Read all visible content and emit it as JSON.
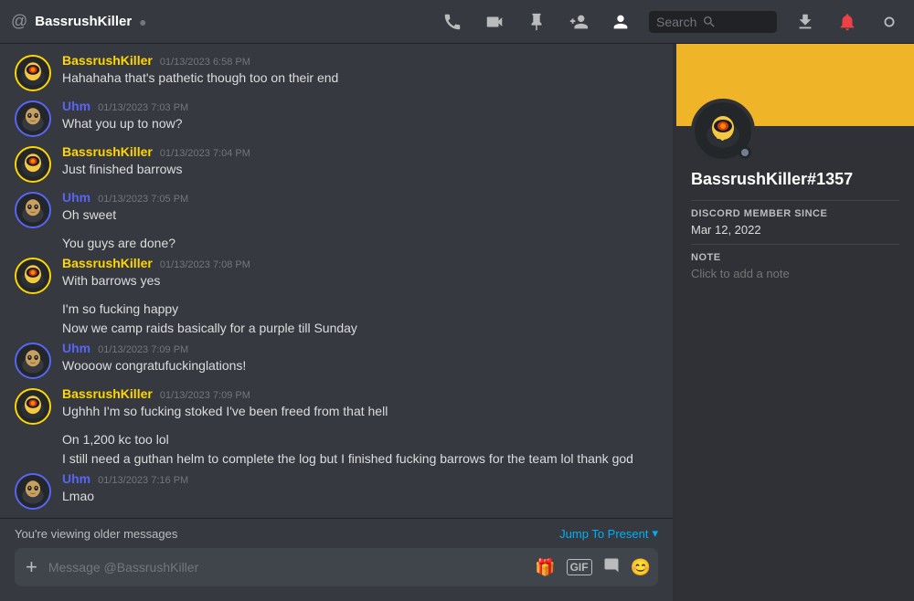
{
  "topbar": {
    "channel_icon": "○",
    "channel_name": "BassrushKiller",
    "verified_icon": "✓",
    "buttons": [
      "📞",
      "📹",
      "★",
      "👤+",
      "🔍"
    ],
    "search_placeholder": "Search",
    "download_icon": "⬇",
    "settings_icon": "⚙"
  },
  "messages": [
    {
      "id": "msg1",
      "author": "BassrushKiller",
      "author_type": "bassrush",
      "timestamp": "01/13/2023 6:58 PM",
      "lines": [
        "Hahahaha that's pathetic though too on their end"
      ]
    },
    {
      "id": "msg2",
      "author": "Uhm",
      "author_type": "uhm",
      "timestamp": "01/13/2023 7:03 PM",
      "lines": [
        "What you up to now?"
      ]
    },
    {
      "id": "msg3",
      "author": "BassrushKiller",
      "author_type": "bassrush",
      "timestamp": "01/13/2023 7:04 PM",
      "lines": [
        "Just finished barrows"
      ]
    },
    {
      "id": "msg4",
      "author": "Uhm",
      "author_type": "uhm",
      "timestamp": "01/13/2023 7:05 PM",
      "lines": [
        "Oh sweet",
        "You guys are done?"
      ]
    },
    {
      "id": "msg5",
      "author": "BassrushKiller",
      "author_type": "bassrush",
      "timestamp": "01/13/2023 7:08 PM",
      "lines": [
        "With barrows yes",
        "I'm so fucking happy",
        "Now we camp raids basically for a purple till Sunday"
      ]
    },
    {
      "id": "msg6",
      "author": "Uhm",
      "author_type": "uhm",
      "timestamp": "01/13/2023 7:09 PM",
      "lines": [
        "Woooow congratufuckinglations!"
      ]
    },
    {
      "id": "msg7",
      "author": "BassrushKiller",
      "author_type": "bassrush",
      "timestamp": "01/13/2023 7:09 PM",
      "lines": [
        "Ughhh I'm so fucking stoked I've been freed from that hell",
        "On 1,200 kc too lol",
        "I still need a guthan helm to complete the log but I finished fucking barrows for the team lol thank god"
      ]
    },
    {
      "id": "msg8",
      "author": "Uhm",
      "author_type": "uhm",
      "timestamp": "01/13/2023 7:16 PM",
      "lines": [
        "Lmao"
      ]
    }
  ],
  "jump_bar": {
    "viewing_text": "You're viewing older messages",
    "jump_label": "Jump To Present",
    "chevron": "▾"
  },
  "input": {
    "placeholder": "Message @BassrushKiller",
    "add_icon": "+",
    "icons": [
      "🎁",
      "GIF",
      "📎",
      "😊"
    ]
  },
  "profile": {
    "banner_color": "#f0b429",
    "username": "BassrushKiller#1357",
    "avatar_emoji": "🧙",
    "member_since_label": "DISCORD MEMBER SINCE",
    "member_since": "Mar 12, 2022",
    "note_label": "NOTE",
    "note_placeholder": "Click to add a note"
  }
}
